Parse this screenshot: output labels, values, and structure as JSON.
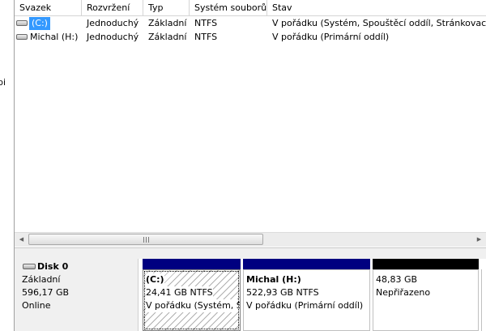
{
  "left_strip_text": "pi",
  "columns": [
    "Svazek",
    "Rozvržení",
    "Typ",
    "Systém souborů",
    "Stav"
  ],
  "volumes": [
    {
      "name": "(C:)",
      "layout": "Jednoduchý",
      "type": "Základní",
      "fs": "NTFS",
      "status": "V pořádku (Systém, Spouštěcí oddíl, Stránkovací so",
      "selected": true
    },
    {
      "name": "Michal (H:)",
      "layout": "Jednoduchý",
      "type": "Základní",
      "fs": "NTFS",
      "status": "V pořádku (Primární oddíl)",
      "selected": false
    }
  ],
  "scrollbar": {
    "left_arrow": "◀",
    "right_arrow": "▶"
  },
  "disk": {
    "name": "Disk 0",
    "type": "Základní",
    "size": "596,17 GB",
    "state": "Online"
  },
  "partitions": [
    {
      "name": "(C:)",
      "size": "24,41 GB NTFS",
      "status": "V pořádku (Systém, S",
      "bar_color": "#000080"
    },
    {
      "name": "Michal  (H:)",
      "size": "522,93 GB NTFS",
      "status": "V pořádku (Primární oddíl)",
      "bar_color": "#000080"
    },
    {
      "name": "",
      "size": "48,83 GB",
      "status": "Nepřiřazeno",
      "bar_color": "#000000"
    }
  ]
}
